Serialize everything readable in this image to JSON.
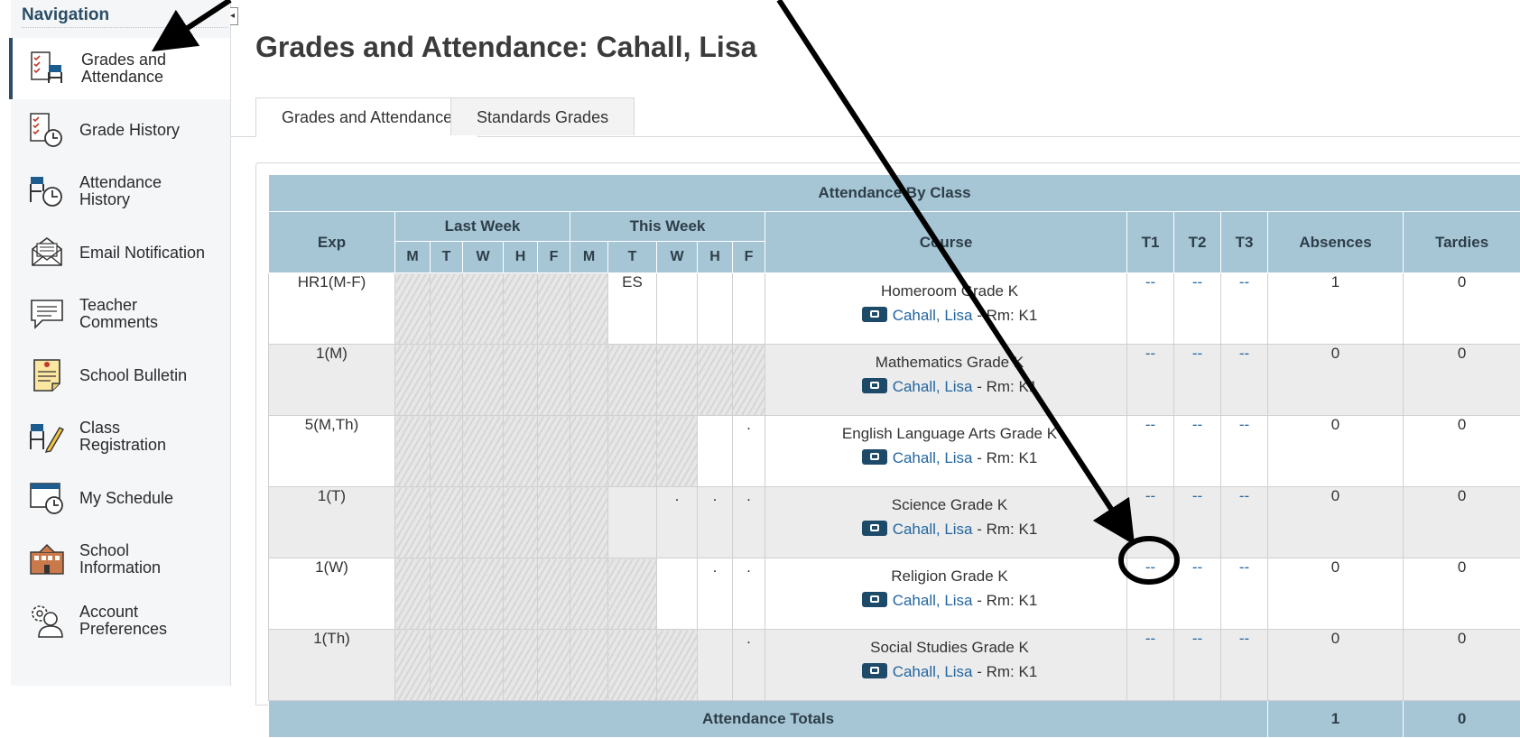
{
  "sidebar": {
    "title": "Navigation",
    "collapse_glyph": "◂",
    "items": [
      {
        "label": "Grades and Attendance",
        "icon": "grades-attendance-icon",
        "active": true
      },
      {
        "label": "Grade History",
        "icon": "grade-history-icon"
      },
      {
        "label": "Attendance History",
        "icon": "attendance-history-icon"
      },
      {
        "label": "Email Notification",
        "icon": "email-icon"
      },
      {
        "label": "Teacher Comments",
        "icon": "comment-icon"
      },
      {
        "label": "School Bulletin",
        "icon": "bulletin-icon"
      },
      {
        "label": "Class Registration",
        "icon": "class-registration-icon"
      },
      {
        "label": "My Schedule",
        "icon": "schedule-icon"
      },
      {
        "label": "School Information",
        "icon": "school-icon"
      },
      {
        "label": "Account Preferences",
        "icon": "account-preferences-icon"
      }
    ]
  },
  "main": {
    "title": "Grades and Attendance: Cahall, Lisa",
    "tabs": [
      {
        "label": "Grades and Attendance",
        "active": true
      },
      {
        "label": "Standards Grades",
        "active": false
      }
    ]
  },
  "table": {
    "caption": "Attendance By Class",
    "headers": {
      "exp": "Exp",
      "last_week": "Last Week",
      "this_week": "This Week",
      "days": [
        "M",
        "T",
        "W",
        "H",
        "F"
      ],
      "course": "Course",
      "terms": [
        "T1",
        "T2",
        "T3"
      ],
      "absences": "Absences",
      "tardies": "Tardies"
    },
    "rows": [
      {
        "exp": "HR1(M-F)",
        "course": "Homeroom Grade K",
        "teacher": "Cahall, Lisa",
        "room": " - Rm: K1",
        "t1": "--",
        "t2": "--",
        "t3": "--",
        "absences": "1",
        "tardies": "0",
        "last_week": [
          "",
          "",
          "",
          "",
          ""
        ],
        "this_week": [
          "",
          "ES",
          "",
          "",
          ""
        ]
      },
      {
        "exp": "1(M)",
        "course": "Mathematics Grade K",
        "teacher": "Cahall, Lisa",
        "room": " - Rm: K1",
        "t1": "--",
        "t2": "--",
        "t3": "--",
        "absences": "0",
        "tardies": "0",
        "last_week": [
          "",
          "",
          "",
          "",
          ""
        ],
        "this_week": [
          "",
          "",
          "",
          "",
          ""
        ]
      },
      {
        "exp": "5(M,Th)",
        "course": "English Language Arts Grade K",
        "teacher": "Cahall, Lisa",
        "room": " - Rm: K1",
        "t1": "--",
        "t2": "--",
        "t3": "--",
        "absences": "0",
        "tardies": "0",
        "last_week": [
          "",
          "",
          "",
          "",
          ""
        ],
        "this_week": [
          "",
          "",
          "",
          "",
          "."
        ]
      },
      {
        "exp": "1(T)",
        "course": "Science Grade K",
        "teacher": "Cahall, Lisa",
        "room": " - Rm: K1",
        "t1": "--",
        "t2": "--",
        "t3": "--",
        "absences": "0",
        "tardies": "0",
        "last_week": [
          "",
          "",
          "",
          "",
          ""
        ],
        "this_week": [
          "",
          "",
          ".",
          ".",
          "."
        ]
      },
      {
        "exp": "1(W)",
        "course": "Religion Grade K",
        "teacher": "Cahall, Lisa",
        "room": " - Rm: K1",
        "t1": "--",
        "t2": "--",
        "t3": "--",
        "absences": "0",
        "tardies": "0",
        "last_week": [
          "",
          "",
          "",
          "",
          ""
        ],
        "this_week": [
          "",
          "",
          "",
          ".",
          "."
        ]
      },
      {
        "exp": "1(Th)",
        "course": "Social Studies Grade K",
        "teacher": "Cahall, Lisa",
        "room": " - Rm: K1",
        "t1": "--",
        "t2": "--",
        "t3": "--",
        "absences": "0",
        "tardies": "0",
        "last_week": [
          "",
          "",
          "",
          "",
          ""
        ],
        "this_week": [
          "",
          "",
          "",
          "",
          "."
        ]
      }
    ],
    "totals": {
      "label": "Attendance Totals",
      "absences": "1",
      "tardies": "0"
    }
  },
  "colors": {
    "header_bg": "#a6c6d6",
    "link": "#2466a0",
    "annotation": "#000000"
  }
}
